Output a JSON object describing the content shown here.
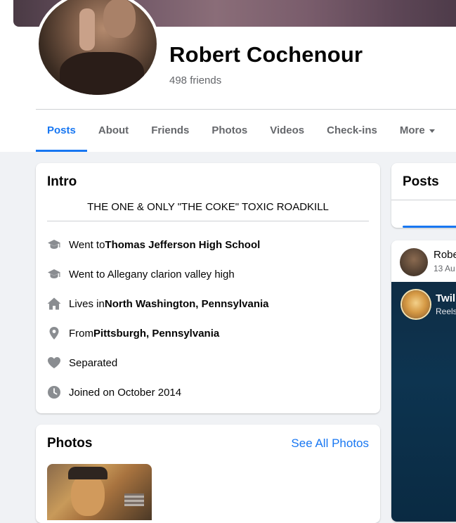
{
  "profile": {
    "name": "Robert Cochenour",
    "friends_count": "498 friends"
  },
  "tabs": [
    {
      "label": "Posts",
      "active": true
    },
    {
      "label": "About"
    },
    {
      "label": "Friends"
    },
    {
      "label": "Photos"
    },
    {
      "label": "Videos"
    },
    {
      "label": "Check-ins"
    },
    {
      "label": "More"
    }
  ],
  "intro": {
    "title": "Intro",
    "bio": "THE ONE & ONLY \"THE COKE\" TOXIC ROADKILL",
    "items": [
      {
        "icon": "graduation-cap-icon",
        "prefix": "Went to ",
        "bold": "Thomas Jefferson High School"
      },
      {
        "icon": "graduation-cap-icon",
        "prefix": "Went to Allegany clarion valley high",
        "bold": ""
      },
      {
        "icon": "home-icon",
        "prefix": "Lives in ",
        "bold": "North Washington, Pennsylvania"
      },
      {
        "icon": "location-pin-icon",
        "prefix": "From ",
        "bold": "Pittsburgh, Pennsylvania"
      },
      {
        "icon": "heart-icon",
        "prefix": "Separated",
        "bold": ""
      },
      {
        "icon": "clock-icon",
        "prefix": "Joined on October 2014",
        "bold": ""
      }
    ]
  },
  "photos": {
    "title": "Photos",
    "see_all": "See All Photos"
  },
  "posts": {
    "title": "Posts",
    "post_author": "Robe",
    "post_date": "13 Au",
    "reel_author": "Twili",
    "reel_sub": "Reels"
  },
  "colors": {
    "accent": "#1877f2",
    "secondary_text": "#65676b",
    "icon_gray": "#8a8d91",
    "page_bg": "#f0f2f5"
  }
}
